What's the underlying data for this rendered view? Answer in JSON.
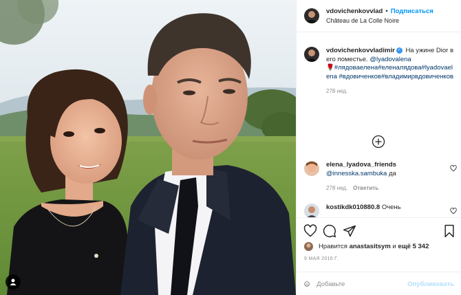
{
  "post": {
    "image_alt": "Selfie of a man and a woman outdoors",
    "user_tag_icon": "person-icon"
  },
  "header": {
    "username": "vdovichenkovvlad",
    "separator": "•",
    "follow_label": "Подписаться",
    "location": "Château de La Colle Noire"
  },
  "caption": {
    "username": "vdovichenkovvladimir",
    "text": "На ужине Dior в его поместье.",
    "mention": "@lyadovalena",
    "emoji": "🌹",
    "hashtags": "#лядоваелена#еленалядова#lyadovaelena #вдовиченков#владимирвдовиченков",
    "age": "278 нед."
  },
  "comments": [
    {
      "username": "elena_lyadova_friends",
      "mention": "@innesska.sambuka",
      "text": "да",
      "age": "278 нед.",
      "reply_label": "Ответить"
    },
    {
      "username": "kostikdk010880.8",
      "text": "Очень"
    }
  ],
  "likes": {
    "prefix": "Нравится",
    "user": "anastasitsym",
    "middle": "и",
    "count": "ещё 5 342"
  },
  "date": "9 МАЯ 2016 Г.",
  "add_comment": {
    "placeholder": "Добавьте",
    "post_label": "Опубликовать"
  },
  "colors": {
    "accent": "#0095f6",
    "link": "#00376b",
    "muted": "#8e8e8e",
    "post_disabled": "#b2dffc"
  }
}
